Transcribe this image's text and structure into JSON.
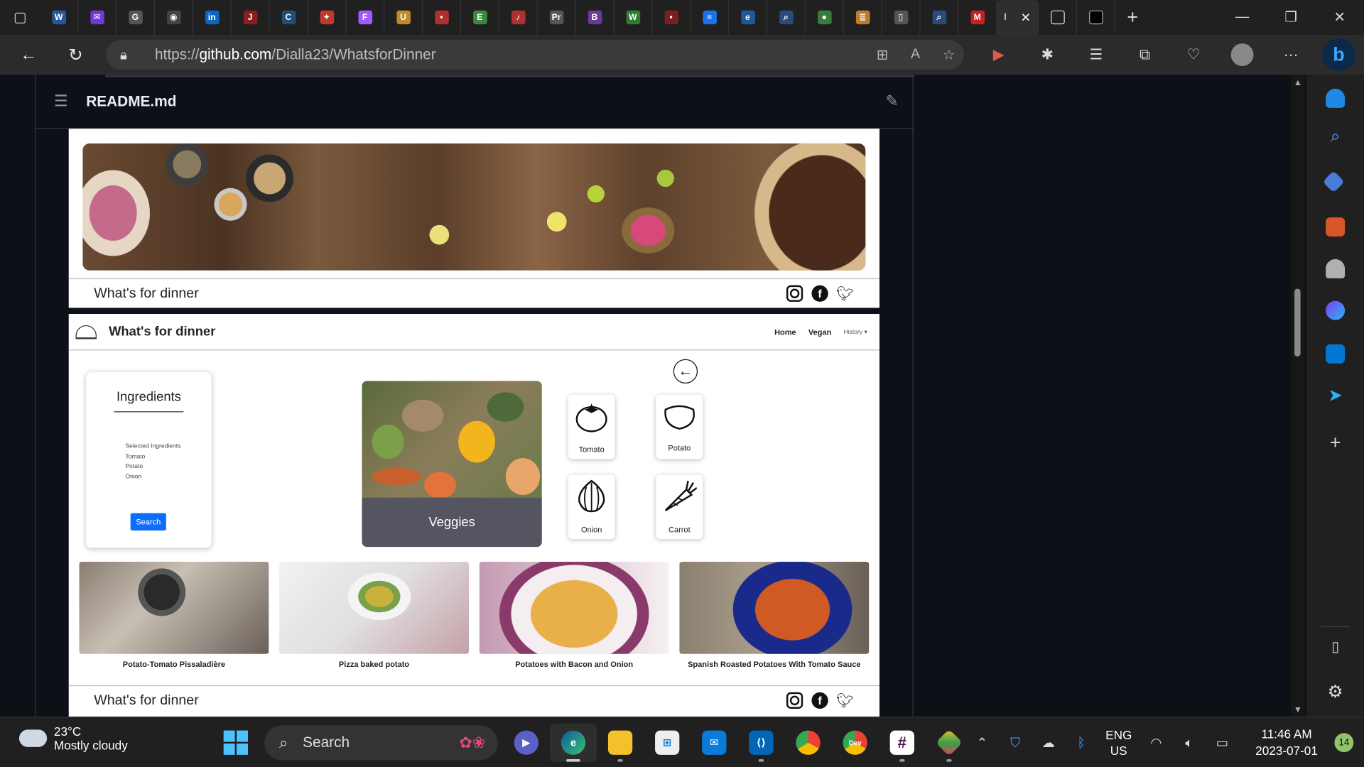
{
  "browser": {
    "tabs": [
      {
        "icon": "word-icon",
        "color": "#2b579a",
        "glyph": "W"
      },
      {
        "icon": "mail-icon",
        "color": "#6e3ad6",
        "glyph": "✉"
      },
      {
        "icon": "refresh-tab-icon",
        "color": "#555555",
        "glyph": "G"
      },
      {
        "icon": "github-icon",
        "color": "#444444",
        "glyph": "◉"
      },
      {
        "icon": "linkedin-icon",
        "color": "#0a66c2",
        "glyph": "in"
      },
      {
        "icon": "red-app-icon",
        "color": "#8b1e1e",
        "glyph": "J"
      },
      {
        "icon": "c-app-icon",
        "color": "#1f4e79",
        "glyph": "C"
      },
      {
        "icon": "maple-leaf-icon",
        "color": "#c0392b",
        "glyph": "✦"
      },
      {
        "icon": "figma-icon",
        "color": "#a259ff",
        "glyph": "F"
      },
      {
        "icon": "shield-tab-icon",
        "color": "#c08a2a",
        "glyph": "U"
      },
      {
        "icon": "red-square-icon",
        "color": "#b03030",
        "glyph": "▪"
      },
      {
        "icon": "green-circle-icon",
        "color": "#3a8a3a",
        "glyph": "E"
      },
      {
        "icon": "music-icon",
        "color": "#b03030",
        "glyph": "♪"
      },
      {
        "icon": "premiere-icon",
        "color": "#555555",
        "glyph": "Pr"
      },
      {
        "icon": "b-app-icon",
        "color": "#6a3a9a",
        "glyph": "B"
      },
      {
        "icon": "w-green-icon",
        "color": "#2e7d32",
        "glyph": "W"
      },
      {
        "icon": "dark-red-icon",
        "color": "#7a1f1f",
        "glyph": "▪"
      },
      {
        "icon": "docs-icon",
        "color": "#1a73e8",
        "glyph": "≡"
      },
      {
        "icon": "edge-tab-icon",
        "color": "#1e5a9a",
        "glyph": "e"
      },
      {
        "icon": "search-tab-icon",
        "color": "#2a4a7a",
        "glyph": "⌕"
      },
      {
        "icon": "frog-icon",
        "color": "#3a7a3a",
        "glyph": "●"
      },
      {
        "icon": "stack-icon",
        "color": "#c07a2a",
        "glyph": "≣"
      },
      {
        "icon": "page-tab-icon",
        "color": "#555555",
        "glyph": "▯"
      },
      {
        "icon": "search-tab-icon-2",
        "color": "#2a4a7a",
        "glyph": "⌕"
      },
      {
        "icon": "gmail-icon",
        "color": "#c5221f",
        "glyph": "M"
      }
    ],
    "url_prefix": "https://",
    "url_host": "github.com",
    "url_path": "/Dialla23/WhatsforDinner"
  },
  "readme": {
    "filename": "README.md"
  },
  "app": {
    "brand": "What's for dinner",
    "nav_home": "Home",
    "nav_vegan": "Vegan",
    "nav_history": "History ▾",
    "ingredients_title": "Ingredients",
    "selected_ingredients": [
      "Selected Ingredients",
      "Tomato",
      "Potato",
      "Onion"
    ],
    "search_label": "Search",
    "category_label": "Veggies",
    "vegetables": [
      {
        "label": "Tomato",
        "icon": "tomato-icon"
      },
      {
        "label": "Potato",
        "icon": "potato-icon"
      },
      {
        "label": "Onion",
        "icon": "onion-icon"
      },
      {
        "label": "Carrot",
        "icon": "carrot-icon"
      }
    ],
    "recipes": [
      "Potato-Tomato Pissaladière",
      "Pizza baked potato",
      "Potatoes with Bacon and Onion",
      "Spanish Roasted Potatoes With Tomato Sauce"
    ],
    "footer_title": "What's for dinner"
  },
  "taskbar": {
    "temperature": "23°C",
    "weather": "Mostly cloudy",
    "search_label": "Search",
    "lang_1": "ENG",
    "lang_2": "US",
    "time": "11:46 AM",
    "date": "2023-07-01",
    "notifications": "14"
  }
}
